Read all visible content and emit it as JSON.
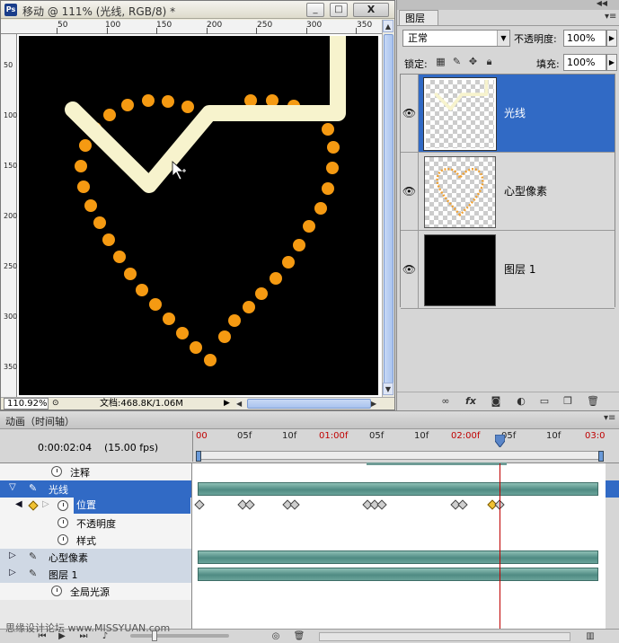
{
  "document": {
    "title": "移动 @ 111% (光线, RGB/8) *",
    "ps_icon": "Ps",
    "window_buttons": {
      "minimize": "_",
      "maximize": "□",
      "close": "X"
    },
    "ruler_top": [
      "50",
      "100",
      "150",
      "200",
      "250",
      "300",
      "350"
    ],
    "ruler_left": [
      "50",
      "100",
      "150",
      "200",
      "250",
      "300",
      "350"
    ],
    "zoom": "110.92%",
    "doc_info": "文档:468.8K/1.06M",
    "colors": {
      "heart_dot": "#f59a12",
      "light_path": "#f7f3cd",
      "canvas": "#000000"
    }
  },
  "layers_panel": {
    "tab": "图层",
    "blend_mode": "正常",
    "opacity_label": "不透明度:",
    "opacity_value": "100%",
    "lock_label": "锁定:",
    "fill_label": "填充:",
    "fill_value": "100%",
    "layers": [
      {
        "name": "光线",
        "visible": true,
        "selected": true,
        "thumb": "light-thumb"
      },
      {
        "name": "心型像素",
        "visible": true,
        "selected": false,
        "thumb": "heart-thumb"
      },
      {
        "name": "图层 1",
        "visible": true,
        "selected": false,
        "thumb": "black-thumb"
      }
    ],
    "bottom_icons": [
      "link-icon",
      "fx-icon",
      "mask-icon",
      "adjustment-icon",
      "folder-icon",
      "new-layer-icon",
      "trash-icon"
    ]
  },
  "animation": {
    "title": "动画（时间轴）",
    "current_time": "0:00:02:04",
    "fps": "(15.00 fps)",
    "time_labels": [
      {
        "text": "00",
        "sec": true
      },
      {
        "text": "05f",
        "sec": false
      },
      {
        "text": "10f",
        "sec": false
      },
      {
        "text": "01:00f",
        "sec": true
      },
      {
        "text": "05f",
        "sec": false
      },
      {
        "text": "10f",
        "sec": false
      },
      {
        "text": "02:00f",
        "sec": true
      },
      {
        "text": "05f",
        "sec": false
      },
      {
        "text": "10f",
        "sec": false
      },
      {
        "text": "03:0",
        "sec": true
      }
    ],
    "tracks": {
      "comments": "注释",
      "layer_light": "光线",
      "position": "位置",
      "opacity": "不透明度",
      "style": "样式",
      "layer_heart": "心型像素",
      "layer_1": "图层 1",
      "global_light": "全局光源"
    },
    "watermark": "思缘设计论坛 www.MISSYUAN.com"
  }
}
